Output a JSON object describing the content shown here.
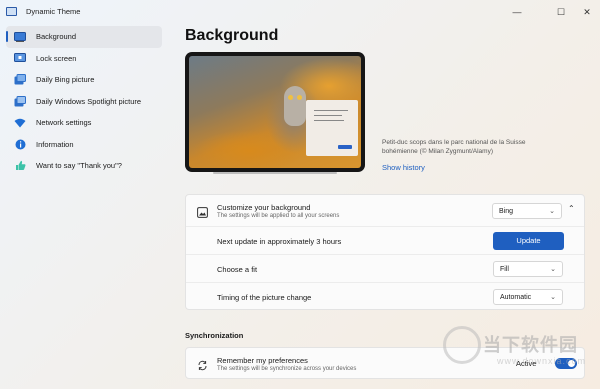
{
  "window": {
    "title": "Dynamic Theme",
    "controls": {
      "minimize": "—",
      "maximize": "☐",
      "close": "✕"
    }
  },
  "sidebar": {
    "items": [
      {
        "label": "Background",
        "icon": "background-icon",
        "active": true
      },
      {
        "label": "Lock screen",
        "icon": "lock-screen-icon"
      },
      {
        "label": "Daily Bing picture",
        "icon": "bing-picture-icon"
      },
      {
        "label": "Daily Windows Spotlight picture",
        "icon": "spotlight-icon"
      },
      {
        "label": "Network settings",
        "icon": "wifi-icon"
      },
      {
        "label": "Information",
        "icon": "info-icon"
      },
      {
        "label": "Want to say \"Thank you\"?",
        "icon": "thumbs-up-icon"
      }
    ]
  },
  "main": {
    "title": "Background",
    "caption": "Petit-duc scops dans le parc national de la Suisse bohémienne (© Milan Zygmunt/Alamy)",
    "show_history": "Show history",
    "customize": {
      "title": "Customize your background",
      "subtitle": "The settings will be applied to all your screens",
      "source_value": "Bing",
      "collapse_glyph": "⌃"
    },
    "next_update": {
      "label": "Next update in approximately 3 hours",
      "button": "Update"
    },
    "fit": {
      "label": "Choose a fit",
      "value": "Fill"
    },
    "timing": {
      "label": "Timing of the picture change",
      "value": "Automatic"
    },
    "sync": {
      "section_title": "Synchronization",
      "title": "Remember my preferences",
      "subtitle": "The settings will be synchronize across your devices",
      "toggle_label": "Active",
      "toggle_on": true
    }
  },
  "watermark": {
    "text": "当下软件园",
    "sub": "www.downxia.com"
  },
  "colors": {
    "accent": "#1f5fc0",
    "card": "#fbfbfb"
  }
}
